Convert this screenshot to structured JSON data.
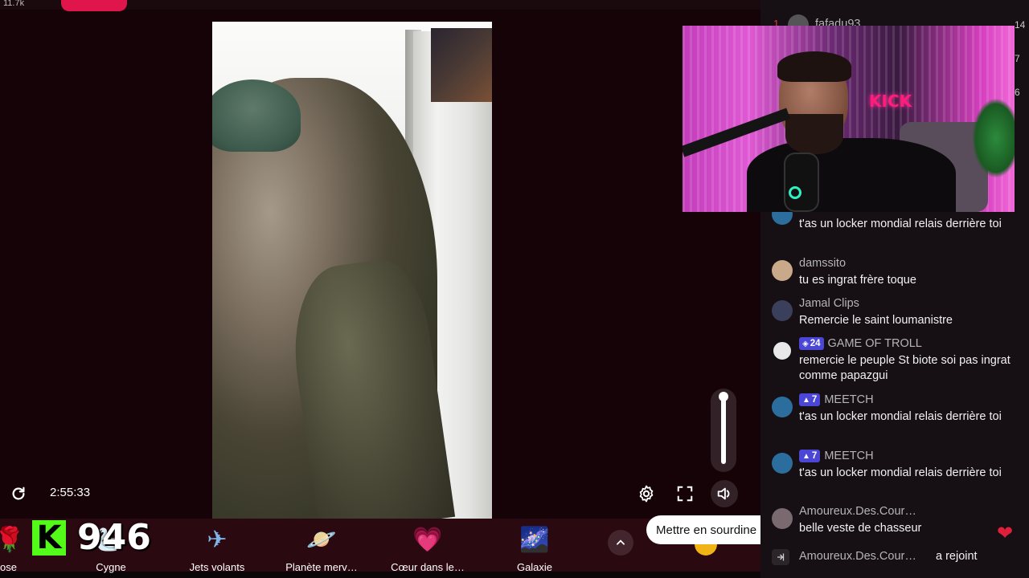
{
  "top_strip": {
    "count": "11.7k"
  },
  "player": {
    "time": "2:55:33",
    "tooltip": "Mettre en sourdine (M)",
    "volume_fraction": 1.0
  },
  "kick_badge": {
    "letter": "K",
    "count": "946"
  },
  "gifts": [
    {
      "label": "ose",
      "icon": "rose-icon",
      "glyph": "🌹"
    },
    {
      "label": "Cygne",
      "icon": "swan-icon",
      "glyph": "🦢"
    },
    {
      "label": "Jets volants",
      "icon": "jets-icon",
      "glyph": "✈"
    },
    {
      "label": "Planète merv…",
      "icon": "planet-icon",
      "glyph": "🪐"
    },
    {
      "label": "Cœur dans le…",
      "icon": "heart-hands-icon",
      "glyph": "💗"
    },
    {
      "label": "Galaxie",
      "icon": "galaxy-icon",
      "glyph": "🌌"
    }
  ],
  "chat": {
    "top_user": {
      "rank": "1",
      "name": "fafadu93"
    },
    "side_numbers": [
      "14",
      "7",
      "6"
    ],
    "messages": [
      {
        "name": "",
        "badge": "",
        "text": "t'as un locker mondial relais derrière toi",
        "avatar_color": "#2b6e9e"
      },
      {
        "name": "damssito",
        "badge": "",
        "text": "tu es ingrat frère toque",
        "avatar_color": "#c9a98a"
      },
      {
        "name": "Jamal Clips",
        "badge": "",
        "text": "Remercie le saint loumanistre",
        "avatar_color": "#3a3f5c"
      },
      {
        "name": "GAME OF TROLL",
        "badge": "24",
        "badge_icon": "◈",
        "text": "remercie le peuple St biote soi pas ingrat comme papazgui",
        "avatar_color": "#e8e8e8"
      },
      {
        "name": "MEETCH",
        "badge": "7",
        "badge_icon": "▲",
        "text": "t'as un locker mondial relais derrière toi",
        "avatar_color": "#2b6e9e"
      },
      {
        "name": "MEETCH",
        "badge": "7",
        "badge_icon": "▲",
        "text": "t'as un locker mondial relais derrière toi",
        "avatar_color": "#2b6e9e"
      },
      {
        "name": "Amoureux.Des.Cour…",
        "badge": "",
        "text": "belle veste de chasseur",
        "avatar_color": "#7a6a70"
      }
    ],
    "joined": {
      "name": "Amoureux.Des.Cour…",
      "text": "a rejoint"
    }
  },
  "webcam": {
    "sign": "KICK"
  },
  "colors": {
    "kick_green": "#53fc18",
    "badge_purple": "#4b46d6",
    "live_red": "#e0154b"
  }
}
